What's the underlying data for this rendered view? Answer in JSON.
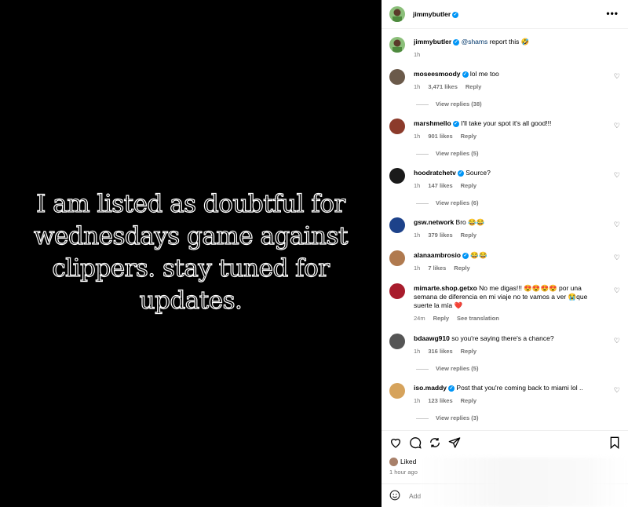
{
  "media": {
    "text": "I am listed as doubtful for wednesdays game against clippers. stay tuned for updates."
  },
  "header": {
    "username": "jimmybutler",
    "more_icon": "more-horizontal-icon"
  },
  "caption": {
    "username": "jimmybutler",
    "mention": "@shams",
    "text": " report this 🤣",
    "time": "1h"
  },
  "comments": [
    {
      "username": "moseesmoody",
      "verified": true,
      "text": "lol me too",
      "time": "1h",
      "likes": "3,471 likes",
      "reply": "Reply",
      "view_replies": "View replies (38)",
      "avatar_color": "#6b5a4a"
    },
    {
      "username": "marshmello",
      "verified": true,
      "text": "I'll take your spot it's all good!!!",
      "time": "1h",
      "likes": "901 likes",
      "reply": "Reply",
      "view_replies": "View replies (5)",
      "avatar_color": "#8c3b2b"
    },
    {
      "username": "hoodratchetv",
      "verified": true,
      "text": "Source?",
      "time": "1h",
      "likes": "147 likes",
      "reply": "Reply",
      "view_replies": "View replies (6)",
      "avatar_color": "#1a1a1a"
    },
    {
      "username": "gsw.network",
      "verified": false,
      "text": "Bro 😂😂",
      "time": "1h",
      "likes": "379 likes",
      "reply": "Reply",
      "avatar_color": "#1d428a"
    },
    {
      "username": "alanaambrosio",
      "verified": true,
      "text": "😂😂",
      "time": "1h",
      "likes": "7 likes",
      "reply": "Reply",
      "avatar_color": "#b07a4f"
    },
    {
      "username": "mimarte.shop.getxo",
      "verified": false,
      "text": "No me digas!!! 😍😍😍😍 por una semana de diferencia en mi viaje no te vamos a ver 😭que suerte la mía ❤️",
      "time": "24m",
      "reply": "Reply",
      "see_translation": "See translation",
      "avatar_color": "#a81c2c"
    },
    {
      "username": "bdaawg910",
      "verified": false,
      "text": "so you're saying there's a chance?",
      "time": "1h",
      "likes": "316 likes",
      "reply": "Reply",
      "view_replies": "View replies (5)",
      "avatar_color": "#555555"
    },
    {
      "username": "iso.maddy",
      "verified": true,
      "text": "Post that you're coming back to miami lol ..",
      "time": "1h",
      "likes": "123 likes",
      "reply": "Reply",
      "view_replies": "View replies (3)",
      "avatar_color": "#d6a35c"
    }
  ],
  "actions": {
    "like_icon": "heart-icon",
    "comment_icon": "comment-icon",
    "repost_icon": "repost-icon",
    "share_icon": "send-icon",
    "save_icon": "bookmark-icon"
  },
  "likes_summary": "Liked",
  "time_ago": "1 hour ago",
  "add_comment": {
    "placeholder": "Add",
    "emoji_icon": "emoji-icon"
  }
}
